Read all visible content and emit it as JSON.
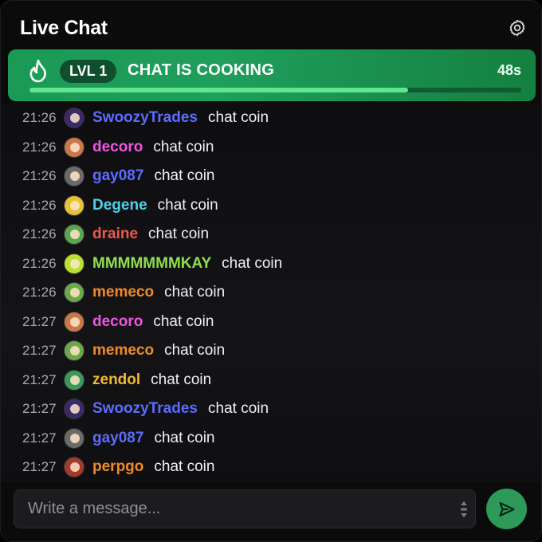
{
  "header": {
    "title": "Live Chat",
    "settings_icon": "gear-icon"
  },
  "banner": {
    "icon": "flame-icon",
    "level": "LVL 1",
    "message": "CHAT IS COOKING",
    "timer": "48s",
    "progress_fraction": 0.77,
    "color": "#1f9f5c"
  },
  "messages": [
    {
      "time": "21:26",
      "user": "SwoozyTrades",
      "color": "#5b6cff",
      "avatar_color": "#3a2a6a",
      "text": "chat coin"
    },
    {
      "time": "21:26",
      "user": "decoro",
      "color": "#ee55e0",
      "avatar_color": "#c9784a",
      "text": "chat coin"
    },
    {
      "time": "21:26",
      "user": "gay087",
      "color": "#5b6cff",
      "avatar_color": "#6a6a6a",
      "text": "chat coin"
    },
    {
      "time": "21:26",
      "user": "Degene",
      "color": "#4fd1ea",
      "avatar_color": "#e8c13a",
      "text": "chat coin"
    },
    {
      "time": "21:26",
      "user": "draine",
      "color": "#f0564b",
      "avatar_color": "#5aa64e",
      "text": "chat coin"
    },
    {
      "time": "21:26",
      "user": "MMMMMMMKAY",
      "color": "#8fe04a",
      "avatar_color": "#b9e032",
      "text": "chat coin"
    },
    {
      "time": "21:26",
      "user": "memeco",
      "color": "#f08a2a",
      "avatar_color": "#6aa84a",
      "text": "chat coin"
    },
    {
      "time": "21:27",
      "user": "decoro",
      "color": "#ee55e0",
      "avatar_color": "#c9784a",
      "text": "chat coin"
    },
    {
      "time": "21:27",
      "user": "memeco",
      "color": "#f08a2a",
      "avatar_color": "#6aa84a",
      "text": "chat coin"
    },
    {
      "time": "21:27",
      "user": "zendol",
      "color": "#f2b92e",
      "avatar_color": "#3a9a5a",
      "text": "chat coin"
    },
    {
      "time": "21:27",
      "user": "SwoozyTrades",
      "color": "#5b6cff",
      "avatar_color": "#3a2a6a",
      "text": "chat coin"
    },
    {
      "time": "21:27",
      "user": "gay087",
      "color": "#5b6cff",
      "avatar_color": "#6a6a6a",
      "text": "chat coin"
    },
    {
      "time": "21:27",
      "user": "perpgo",
      "color": "#f08a2a",
      "avatar_color": "#a33a2a",
      "text": "chat coin"
    }
  ],
  "composer": {
    "placeholder": "Write a message...",
    "value": "",
    "resize_icon": "resize-handle-icon",
    "send_icon": "send-icon",
    "send_color": "#2e9a59"
  }
}
